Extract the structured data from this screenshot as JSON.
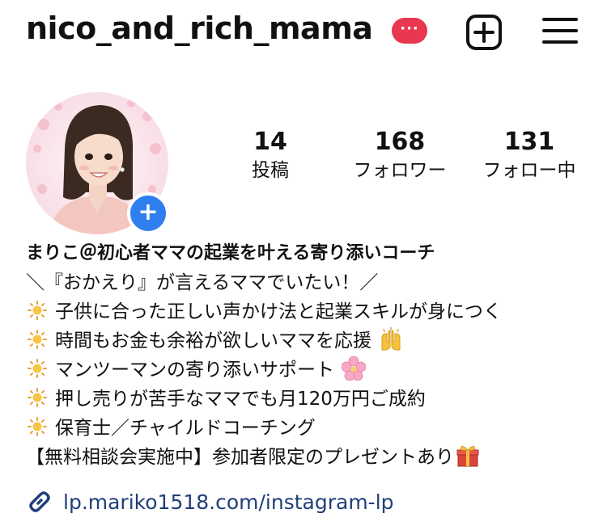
{
  "header": {
    "username": "nico_and_rich_mama",
    "badge": "···",
    "badge_color": "#e8374f"
  },
  "stats": {
    "posts": {
      "value": "14",
      "label": "投稿"
    },
    "followers": {
      "value": "168",
      "label": "フォロワー"
    },
    "following": {
      "value": "131",
      "label": "フォロー中"
    }
  },
  "avatar": {
    "add_story": "+",
    "add_story_color": "#2f7ff0"
  },
  "bio": {
    "name": "まりこ＠初心者ママの起業を叶える寄り添いコーチ",
    "tagline": "＼『おかえり』が言えるママでいたい！／",
    "points": [
      "子供に合った正しい声かけ法と起業スキルが身につく",
      "時間もお金も余裕が欲しいママを応援",
      "マンツーマンの寄り添いサポート",
      "押し売りが苦手なママでも月120万円ご成約",
      "保育士／チャイルドコーチング"
    ],
    "cta": "【無料相談会実施中】参加者限定のプレゼントあり"
  },
  "link": {
    "url": "lp.mariko1518.com/instagram-lp",
    "color": "#1f3f7a"
  },
  "icons": {
    "bullet": "sun-icon",
    "emoji_1": "raising-hands-icon",
    "emoji_2": "cherry-blossom-icon",
    "emoji_3": "gift-icon"
  }
}
